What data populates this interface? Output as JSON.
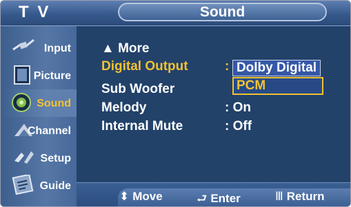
{
  "header": {
    "tv_label": "T V",
    "title": "Sound"
  },
  "sidebar": {
    "items": [
      {
        "label": "Input",
        "icon": "input-plug-icon"
      },
      {
        "label": "Picture",
        "icon": "picture-icon"
      },
      {
        "label": "Sound",
        "icon": "speaker-icon",
        "active": true
      },
      {
        "label": "Channel",
        "icon": "channel-icon"
      },
      {
        "label": "Setup",
        "icon": "setup-icon"
      },
      {
        "label": "Guide",
        "icon": "guide-icon"
      }
    ]
  },
  "menu": {
    "more": "▲ More",
    "digital_output": {
      "label": "Digital Output",
      "colon": ":",
      "options": [
        "Dolby Digital",
        "PCM"
      ],
      "selected": "PCM"
    },
    "sub_woofer": {
      "label": "Sub Woofer"
    },
    "melody": {
      "label": "Melody",
      "value": ": On"
    },
    "internal_mute": {
      "label": "Internal Mute",
      "value": ": Off"
    }
  },
  "footer": {
    "move": "Move",
    "enter": "Enter",
    "return": "Return"
  },
  "colors": {
    "accent_yellow": "#f2c230",
    "background": "#22426a",
    "header": "#36598d"
  }
}
